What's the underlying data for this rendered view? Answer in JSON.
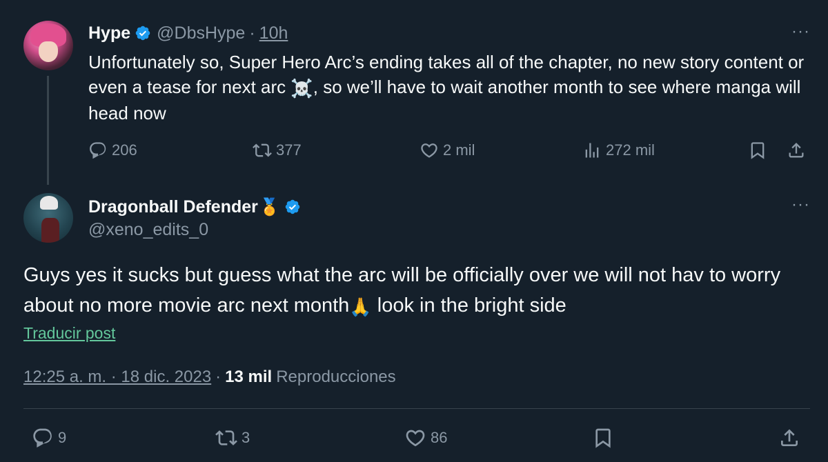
{
  "parent_tweet": {
    "author_name": "Hype",
    "handle": "@DbsHype",
    "separator": "·",
    "time": "10h",
    "more_label": "···",
    "text_part1": "Unfortunately so, Super Hero Arc’s ending takes all of the chapter, no new story content or even a tease for next arc ",
    "emoji": "☠️",
    "text_part2": ", so we’ll have to wait another month to see where manga will head now",
    "replies": "206",
    "retweets": "377",
    "likes": "2 mil",
    "views": "272 mil"
  },
  "main_tweet": {
    "author_name": "Dragonball Defender",
    "medal": "🏅",
    "handle": "@xeno_edits_0",
    "more_label": "···",
    "text_part1": "Guys yes it sucks but guess what the arc will be officially over we will not hav to worry about no more movie arc next month",
    "emoji": "🙏",
    "text_part2": " look in the bright side",
    "translate_label": "Traducir post",
    "timestamp": "12:25 a. m. · 18 dic. 2023",
    "meta_separator": "·",
    "views_count": "13 mil",
    "views_label": "Reproducciones",
    "replies": "9",
    "retweets": "3",
    "likes": "86"
  },
  "colors": {
    "background": "#15202b",
    "text_primary": "#f7f9f9",
    "text_secondary": "#8b98a5",
    "verified_blue": "#1d9bf0",
    "translate_link": "#64c89c",
    "divider": "#38444d"
  },
  "icons": [
    "reply-icon",
    "retweet-icon",
    "like-icon",
    "views-icon",
    "bookmark-icon",
    "share-icon",
    "verified-badge-icon",
    "more-icon"
  ]
}
